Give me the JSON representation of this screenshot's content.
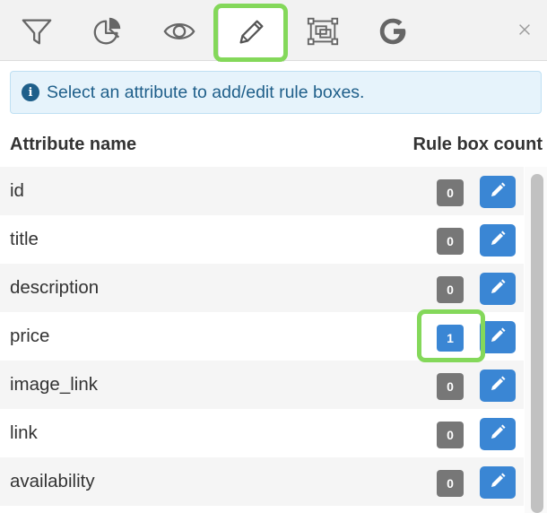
{
  "toolbar": {
    "tabs": [
      {
        "icon": "filter-icon",
        "active": false
      },
      {
        "icon": "pie-chart-icon",
        "active": false
      },
      {
        "icon": "eye-icon",
        "active": false
      },
      {
        "icon": "pencil-icon",
        "active": true
      },
      {
        "icon": "bounding-box-icon",
        "active": false
      },
      {
        "icon": "google-icon",
        "active": false
      }
    ],
    "close_icon": "close-icon"
  },
  "info": {
    "icon": "info-icon",
    "icon_glyph": "i",
    "text": "Select an attribute to add/edit rule boxes."
  },
  "table": {
    "headers": {
      "name": "Attribute name",
      "count": "Rule box count"
    },
    "rows": [
      {
        "name": "id",
        "count": "0",
        "highlighted": false
      },
      {
        "name": "title",
        "count": "0",
        "highlighted": false
      },
      {
        "name": "description",
        "count": "0",
        "highlighted": false
      },
      {
        "name": "price",
        "count": "1",
        "highlighted": true
      },
      {
        "name": "image_link",
        "count": "0",
        "highlighted": false
      },
      {
        "name": "link",
        "count": "0",
        "highlighted": false
      },
      {
        "name": "availability",
        "count": "0",
        "highlighted": false
      }
    ]
  },
  "colors": {
    "accent_blue": "#3a86d4",
    "badge_gray": "#777777",
    "highlight_green": "#84d85a",
    "info_bg": "#e6f3fb",
    "info_text": "#1f5f8a"
  }
}
